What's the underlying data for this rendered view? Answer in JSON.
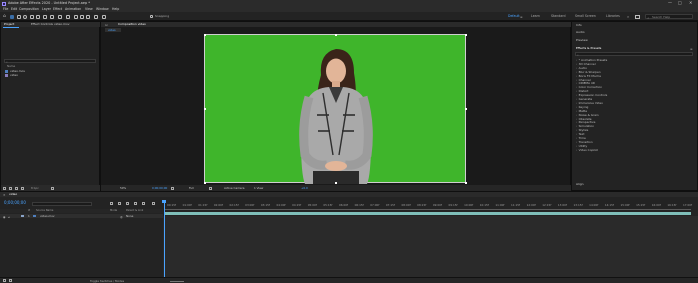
{
  "window": {
    "title": "Adobe After Effects 2020 - Untitled Project.aep *",
    "controls": [
      "—",
      "□",
      "✕"
    ]
  },
  "menu": [
    "File",
    "Edit",
    "Composition",
    "Layer",
    "Effect",
    "Animation",
    "View",
    "Window",
    "Help"
  ],
  "toolbar": {
    "snapping_label": "Snapping",
    "workspaces": [
      {
        "label": "Default",
        "active": true
      },
      {
        "label": "Learn",
        "active": false
      },
      {
        "label": "Standard",
        "active": false
      },
      {
        "label": "Small Screen",
        "active": false
      },
      {
        "label": "Libraries",
        "active": false
      }
    ],
    "search_help_placeholder": "Search Help"
  },
  "project_panel": {
    "tabs": [
      "Project",
      "Effect Controls video.mov"
    ],
    "search_placeholder": "",
    "column_name": "Name",
    "items": [
      {
        "name": "video.mov",
        "icon": "footage-icon",
        "color": "#4f7fbf"
      },
      {
        "name": "video",
        "icon": "composition-icon",
        "color": "#8a7fbf"
      }
    ],
    "bpc_label": "8 bpc"
  },
  "viewer": {
    "tab": "Composition video",
    "subtab": "video",
    "zoom": "50%",
    "timecode": "0;00;00;00",
    "resolution": "Full",
    "camera": "Active Camera",
    "views": "1 View",
    "exposure": "+0.0"
  },
  "right_panels": {
    "info": "Info",
    "audio": "Audio",
    "preview": "Preview",
    "effects_title": "Effects & Presets",
    "effects_search_placeholder": "",
    "effects": [
      "* Animation Presets",
      "3D Channel",
      "Audio",
      "Blur & Sharpen",
      "Boris FX Mocha",
      "Channel",
      "CINEMA 4D",
      "Color Correction",
      "Distort",
      "Expression Controls",
      "Generate",
      "Immersive Video",
      "Keying",
      "Matte",
      "Noise & Grain",
      "Obsolete",
      "Perspective",
      "Simulation",
      "Stylize",
      "Text",
      "Time",
      "Transition",
      "Utility",
      "Video Copilot"
    ],
    "align": "Align"
  },
  "timeline": {
    "tab": "video",
    "timecode": "0;00;00;00",
    "columns": [
      "#",
      "Source Name",
      "Mode",
      "Parent & Link"
    ],
    "layer": {
      "index": "1",
      "name": "video.mov",
      "parent": "None"
    },
    "ruler": [
      "00:15f",
      "01:00f",
      "01:15f",
      "02:00f",
      "02:15f",
      "03:00f",
      "03:15f",
      "04:00f",
      "04:15f",
      "05:00f",
      "05:15f",
      "06:00f",
      "06:15f",
      "07:00f",
      "07:15f",
      "08:00f",
      "08:15f",
      "09:00f",
      "09:15f",
      "10:00f",
      "10:15f",
      "11:00f",
      "11:15f",
      "12:00f",
      "12:15f",
      "13:00f",
      "13:15f",
      "14:00f",
      "14:15f",
      "15:00f",
      "15:15f",
      "16:00f",
      "16:15f",
      "17:00f"
    ],
    "toggle_label": "Toggle Switches / Modes"
  },
  "colors": {
    "accent": "#4aa3ff",
    "chroma_green": "#3fb52b",
    "track": "#7fbfb9"
  }
}
